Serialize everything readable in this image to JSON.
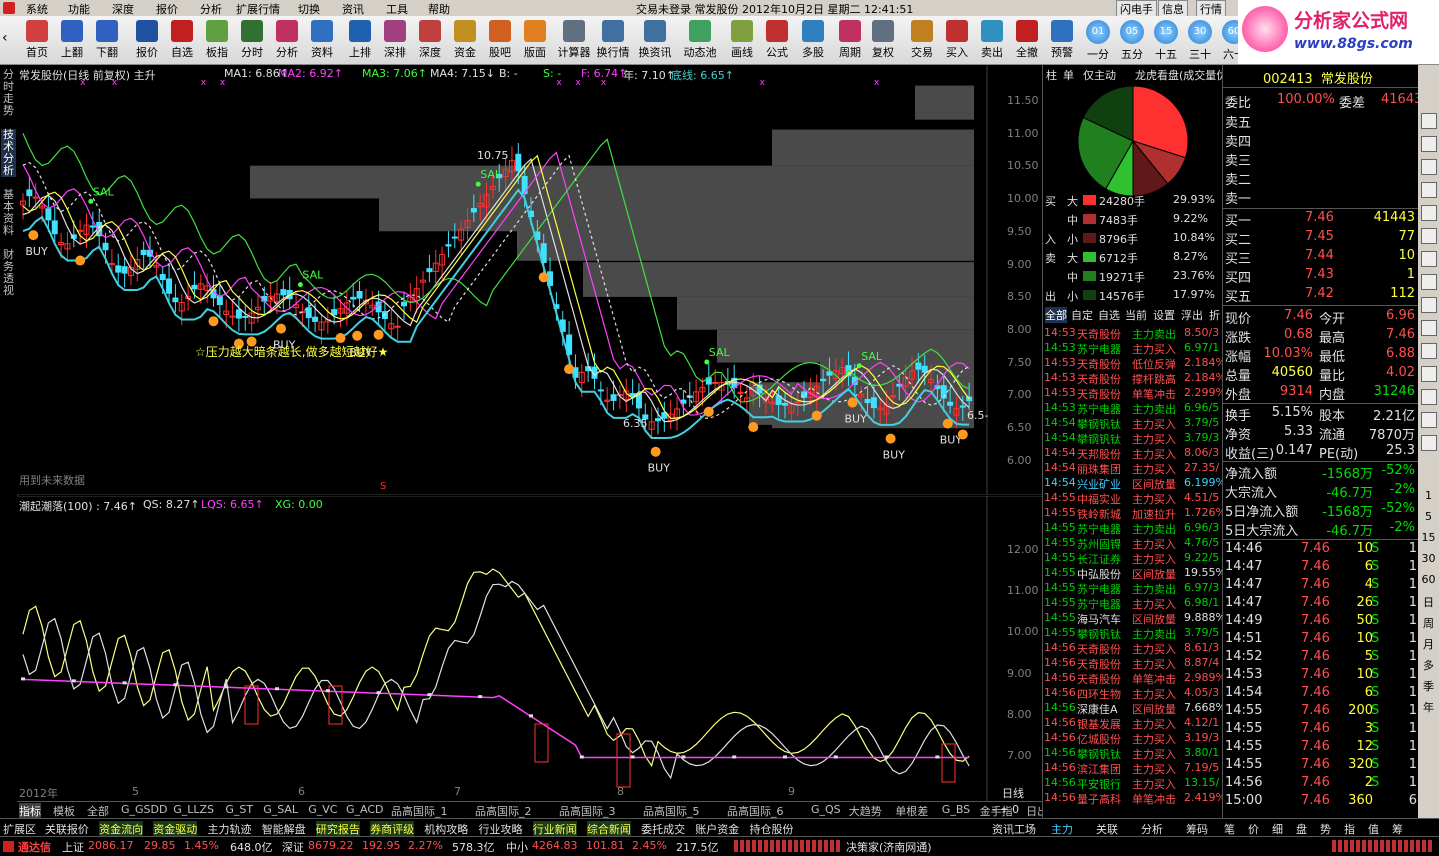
{
  "menu": {
    "items": [
      "系统",
      "功能",
      "深度",
      "报价",
      "分析",
      "扩展行情",
      "切换",
      "资讯",
      "工具",
      "帮助"
    ],
    "center_info": "交易未登录   常发股份   2012年10月2日  星期二  12:41:51",
    "right_buttons": [
      "闪电手",
      "信息",
      "行情"
    ]
  },
  "toolbar": {
    "buttons": [
      "首页",
      "上翻",
      "下翻",
      "报价",
      "自选",
      "板指",
      "分时",
      "分析",
      "资料",
      "上排",
      "深排",
      "深度",
      "资金",
      "股吧",
      "版面",
      "计算器",
      "换行情",
      "换资讯",
      "动态池",
      "画线",
      "公式",
      "多股",
      "周期",
      "复权",
      "交易",
      "买入",
      "卖出",
      "全撤",
      "预警"
    ],
    "period_buttons": [
      {
        "icon": "01",
        "label": "一分"
      },
      {
        "icon": "05",
        "label": "五分"
      },
      {
        "icon": "15",
        "label": "十五"
      },
      {
        "icon": "30",
        "label": "三十"
      },
      {
        "icon": "60",
        "label": "六十"
      }
    ],
    "logo_text": "分析家公式网",
    "logo_url": "www.88gs.com"
  },
  "left_tabs": [
    "分时走势",
    "技术分析",
    "基本资料",
    "财务透视"
  ],
  "main_chart": {
    "title": "常发股份(日线 前复权) 主升",
    "ma_labels": [
      {
        "text": "MA1: 6.86↑",
        "color": "#e0e0e0"
      },
      {
        "text": "MA2: 6.92↑",
        "color": "#ff40ff"
      },
      {
        "text": "MA3: 7.06↑",
        "color": "#40ff40"
      },
      {
        "text": "MA4: 7.15↓",
        "color": "#e0e0e0"
      },
      {
        "text": "B: -",
        "color": "#e0e0e0"
      },
      {
        "text": "S: -",
        "color": "#40ff40"
      },
      {
        "text": "F: 6.74↑",
        "color": "#ff40ff"
      },
      {
        "text": "年: 7.10↑",
        "color": "#e0e0e0"
      },
      {
        "text": "底线: 6.65↑",
        "color": "#40d0d0"
      }
    ],
    "y_ticks": [
      "11.50",
      "11.00",
      "10.50",
      "10.00",
      "9.50",
      "9.00",
      "8.50",
      "8.00",
      "7.50",
      "7.00",
      "6.50",
      "6.00"
    ],
    "annotations": {
      "peak_price": "10.75",
      "low_price": "6.35",
      "slogan": "☆压力越大暗条越长,做多越短越好★",
      "future_hint": "用到未来数据",
      "s_mark": "S",
      "right_value": "6.5-"
    },
    "signal_buy": "BUY",
    "signal_sell": "SAL"
  },
  "sub_chart": {
    "title_items": [
      {
        "text": "潮起潮落(100) : 7.46↑",
        "color": "#e0e0e0"
      },
      {
        "text": "QS: 8.27↑",
        "color": "#e0e0e0"
      },
      {
        "text": "LQS: 6.65↑",
        "color": "#ff40ff"
      },
      {
        "text": "XG: 0.00",
        "color": "#40ff40"
      }
    ],
    "y_ticks": [
      "12.00",
      "11.00",
      "10.00",
      "9.00",
      "8.00",
      "7.00"
    ],
    "x_labels": [
      "2012年",
      "5",
      "6",
      "7",
      "8",
      "9"
    ],
    "period_label": "日线"
  },
  "bottom_tabs": [
    "指标",
    "模板",
    "全部",
    "G_GSDD",
    "G_LLZS",
    "G_ST",
    "G_SAL",
    "G_VC",
    "G_ACD",
    "品高国际_1",
    "品高国际_2",
    "品高国际_3",
    "品高国际_5",
    "品高国际_6",
    "G_QS",
    "大趋势",
    "单根差",
    "G_BS",
    "金手指",
    "日出东海",
    "TT"
  ],
  "bottom_nav": "- + 0",
  "sub_links": [
    "扩展区",
    "关联报价",
    "资金流向",
    "资金驱动",
    "主力轨迹",
    "智能解盘",
    "研究报告",
    "券商评级",
    "机构攻略",
    "行业攻略",
    "行业新闻",
    "综合新闻",
    "委托成交",
    "账户资金",
    "持仓股份"
  ],
  "sub_links_right": [
    "资讯工场",
    "主力",
    "关联",
    "分析",
    "筹码",
    "笔",
    "价",
    "细",
    "盘",
    "势",
    "指",
    "值",
    "筹"
  ],
  "status": {
    "brand": "通达信",
    "sh_label": "上证",
    "sh": "2086.17",
    "sh_ch": "29.85",
    "sh_pct": "1.45%",
    "sh_amt": "648.0亿",
    "sz_label": "深证",
    "sz": "8679.22",
    "sz_ch": "192.95",
    "sz_pct": "2.27%",
    "sz_amt": "578.3亿",
    "zx_label": "中小",
    "zx": "4264.83",
    "zx_ch": "101.81",
    "zx_pct": "2.45%",
    "zx_amt": "217.5亿",
    "right": "决策家(济南网通)"
  },
  "mid_panel": {
    "tabs": [
      "柱",
      "单",
      "仅主动",
      "龙虎看盘(成交量优"
    ],
    "flow_rows": [
      {
        "side": "买",
        "size": "大",
        "color": "#ff3030",
        "val": "24280手",
        "pct": "29.93%"
      },
      {
        "side": "",
        "size": "中",
        "color": "#b03030",
        "val": "7483手",
        "pct": "9.22%"
      },
      {
        "side": "入",
        "size": "小",
        "color": "#601818",
        "val": "8796手",
        "pct": "10.84%"
      },
      {
        "side": "卖",
        "size": "大",
        "color": "#30c030",
        "val": "6712手",
        "pct": "8.27%"
      },
      {
        "side": "",
        "size": "中",
        "color": "#208020",
        "val": "19271手",
        "pct": "23.76%"
      },
      {
        "side": "出",
        "size": "小",
        "color": "#104010",
        "val": "14576手",
        "pct": "17.97%"
      }
    ],
    "filter_tabs": [
      "全部",
      "自定",
      "自选",
      "当前",
      "设置",
      "浮出",
      "折"
    ],
    "news": [
      {
        "t": "14:53",
        "n": "天奇股份",
        "a": "主力卖出",
        "v": "8.50/3",
        "c": "r"
      },
      {
        "t": "14:53",
        "n": "苏宁电器",
        "a": "主力买入",
        "v": "6.97/1",
        "c": "g"
      },
      {
        "t": "14:53",
        "n": "天奇股份",
        "a": "低位反弹",
        "v": "2.184%",
        "c": "r"
      },
      {
        "t": "14:53",
        "n": "天奇股份",
        "a": "撑杆跳高",
        "v": "2.184%",
        "c": "r"
      },
      {
        "t": "14:53",
        "n": "天奇股份",
        "a": "单笔冲击",
        "v": "2.299%",
        "c": "r"
      },
      {
        "t": "14:53",
        "n": "苏宁电器",
        "a": "主力卖出",
        "v": "6.96/5",
        "c": "g"
      },
      {
        "t": "14:54",
        "n": "攀钢钒钛",
        "a": "主力买入",
        "v": "3.79/5",
        "c": "g"
      },
      {
        "t": "14:54",
        "n": "攀钢钒钛",
        "a": "主力买入",
        "v": "3.79/3",
        "c": "g"
      },
      {
        "t": "14:54",
        "n": "天邦股份",
        "a": "主力买入",
        "v": "8.06/3",
        "c": "r"
      },
      {
        "t": "14:54",
        "n": "丽珠集团",
        "a": "主力买入",
        "v": "27.35/",
        "c": "r"
      },
      {
        "t": "14:54",
        "n": "兴业矿业",
        "a": "区间放量",
        "v": "6.199%",
        "c": "c"
      },
      {
        "t": "14:55",
        "n": "中福实业",
        "a": "主力买入",
        "v": "4.51/5",
        "c": "r"
      },
      {
        "t": "14:55",
        "n": "铁岭新城",
        "a": "加速拉升",
        "v": "1.726%",
        "c": "r"
      },
      {
        "t": "14:55",
        "n": "苏宁电器",
        "a": "主力卖出",
        "v": "6.96/3",
        "c": "g"
      },
      {
        "t": "14:55",
        "n": "苏州固锝",
        "a": "主力买入",
        "v": "4.76/5",
        "c": "g"
      },
      {
        "t": "14:55",
        "n": "长江证券",
        "a": "主力买入",
        "v": "9.22/5",
        "c": "g"
      },
      {
        "t": "14:55",
        "n": "中弘股份",
        "a": "区间放量",
        "v": "19.55%",
        "c": "w"
      },
      {
        "t": "14:55",
        "n": "苏宁电器",
        "a": "主力卖出",
        "v": "6.97/3",
        "c": "g"
      },
      {
        "t": "14:55",
        "n": "苏宁电器",
        "a": "主力买入",
        "v": "6.98/1",
        "c": "g"
      },
      {
        "t": "14:55",
        "n": "海马汽车",
        "a": "区间放量",
        "v": "9.888%",
        "c": "w"
      },
      {
        "t": "14:55",
        "n": "攀钢钒钛",
        "a": "主力卖出",
        "v": "3.79/5",
        "c": "g"
      },
      {
        "t": "14:56",
        "n": "天奇股份",
        "a": "主力买入",
        "v": "8.61/3",
        "c": "r"
      },
      {
        "t": "14:56",
        "n": "天奇股份",
        "a": "主力买入",
        "v": "8.87/4",
        "c": "r"
      },
      {
        "t": "14:56",
        "n": "天奇股份",
        "a": "单笔冲击",
        "v": "2.989%",
        "c": "r"
      },
      {
        "t": "14:56",
        "n": "四环生物",
        "a": "主力买入",
        "v": "4.05/3",
        "c": "r"
      },
      {
        "t": "14:56",
        "n": "深康佳A",
        "a": "区间放量",
        "v": "7.668%",
        "c": "w"
      },
      {
        "t": "14:56",
        "n": "银基发展",
        "a": "主力买入",
        "v": "4.12/1",
        "c": "r"
      },
      {
        "t": "14:56",
        "n": "亿城股份",
        "a": "主力买入",
        "v": "3.19/3",
        "c": "r"
      },
      {
        "t": "14:56",
        "n": "攀钢钒钛",
        "a": "主力买入",
        "v": "3.80/1",
        "c": "g"
      },
      {
        "t": "14:56",
        "n": "滨江集团",
        "a": "主力买入",
        "v": "7.19/5",
        "c": "r"
      },
      {
        "t": "14:56",
        "n": "平安银行",
        "a": "主力买入",
        "v": "13.15/",
        "c": "g"
      },
      {
        "t": "14:56",
        "n": "量子高科",
        "a": "单笔冲击",
        "v": "2.419%",
        "c": "r"
      }
    ]
  },
  "right_panel": {
    "code": "002413",
    "name": "常发股份",
    "wb_label": "委比",
    "wb_val": "100.00%",
    "wc_label": "委差",
    "wc_val": "41643",
    "sells": [
      {
        "l": "卖五"
      },
      {
        "l": "卖四"
      },
      {
        "l": "卖三"
      },
      {
        "l": "卖二"
      },
      {
        "l": "卖一"
      }
    ],
    "buys": [
      {
        "l": "买一",
        "p": "7.46",
        "v": "41443"
      },
      {
        "l": "买二",
        "p": "7.45",
        "v": "77"
      },
      {
        "l": "买三",
        "p": "7.44",
        "v": "10"
      },
      {
        "l": "买四",
        "p": "7.43",
        "v": "1"
      },
      {
        "l": "买五",
        "p": "7.42",
        "v": "112"
      }
    ],
    "stats": [
      {
        "a": "现价",
        "av": "7.46",
        "ac": "red",
        "b": "今开",
        "bv": "6.96",
        "bc": "red"
      },
      {
        "a": "涨跌",
        "av": "0.68",
        "ac": "red",
        "b": "最高",
        "bv": "7.46",
        "bc": "red"
      },
      {
        "a": "涨幅",
        "av": "10.03%",
        "ac": "red",
        "b": "最低",
        "bv": "6.88",
        "bc": "red"
      },
      {
        "a": "总量",
        "av": "40560",
        "ac": "yel",
        "b": "量比",
        "bv": "4.02",
        "bc": "red"
      },
      {
        "a": "外盘",
        "av": "9314",
        "ac": "red",
        "b": "内盘",
        "bv": "31246",
        "bc": "green"
      }
    ],
    "stats2": [
      {
        "a": "换手",
        "av": "5.15%",
        "b": "股本",
        "bv": "2.21亿"
      },
      {
        "a": "净资",
        "av": "5.33",
        "b": "流通",
        "bv": "7870万"
      },
      {
        "a": "收益(三)",
        "av": "0.147",
        "b": "PE(动)",
        "bv": "25.3"
      }
    ],
    "flows": [
      {
        "a": "净流入额",
        "v": "-1568万",
        "p": "-52%"
      },
      {
        "a": "大宗流入",
        "v": "-46.7万",
        "p": "-2%"
      },
      {
        "a": "5日净流入额",
        "v": "-1568万",
        "p": "-52%"
      },
      {
        "a": "5日大宗流入",
        "v": "-46.7万",
        "p": "-2%"
      }
    ],
    "ticks": [
      {
        "t": "14:46",
        "p": "7.46",
        "v": "10",
        "s": "S",
        "n": "1"
      },
      {
        "t": "14:47",
        "p": "7.46",
        "v": "6",
        "s": "S",
        "n": "1"
      },
      {
        "t": "14:47",
        "p": "7.46",
        "v": "4",
        "s": "S",
        "n": "1"
      },
      {
        "t": "14:47",
        "p": "7.46",
        "v": "26",
        "s": "S",
        "n": "1"
      },
      {
        "t": "14:49",
        "p": "7.46",
        "v": "50",
        "s": "S",
        "n": "1"
      },
      {
        "t": "14:51",
        "p": "7.46",
        "v": "10",
        "s": "S",
        "n": "1"
      },
      {
        "t": "14:52",
        "p": "7.46",
        "v": "5",
        "s": "S",
        "n": "1"
      },
      {
        "t": "14:53",
        "p": "7.46",
        "v": "10",
        "s": "S",
        "n": "1"
      },
      {
        "t": "14:54",
        "p": "7.46",
        "v": "6",
        "s": "S",
        "n": "1"
      },
      {
        "t": "14:55",
        "p": "7.46",
        "v": "200",
        "s": "S",
        "n": "1"
      },
      {
        "t": "14:55",
        "p": "7.46",
        "v": "3",
        "s": "S",
        "n": "1"
      },
      {
        "t": "14:55",
        "p": "7.46",
        "v": "12",
        "s": "S",
        "n": "1"
      },
      {
        "t": "14:55",
        "p": "7.46",
        "v": "320",
        "s": "S",
        "n": "1"
      },
      {
        "t": "14:56",
        "p": "7.46",
        "v": "2",
        "s": "S",
        "n": "1"
      },
      {
        "t": "15:00",
        "p": "7.46",
        "v": "360",
        "s": "",
        "n": "6"
      }
    ]
  },
  "right_sidebar": [
    "1",
    "5",
    "15",
    "30",
    "60",
    "日",
    "周",
    "月",
    "多",
    "季",
    "年"
  ]
}
